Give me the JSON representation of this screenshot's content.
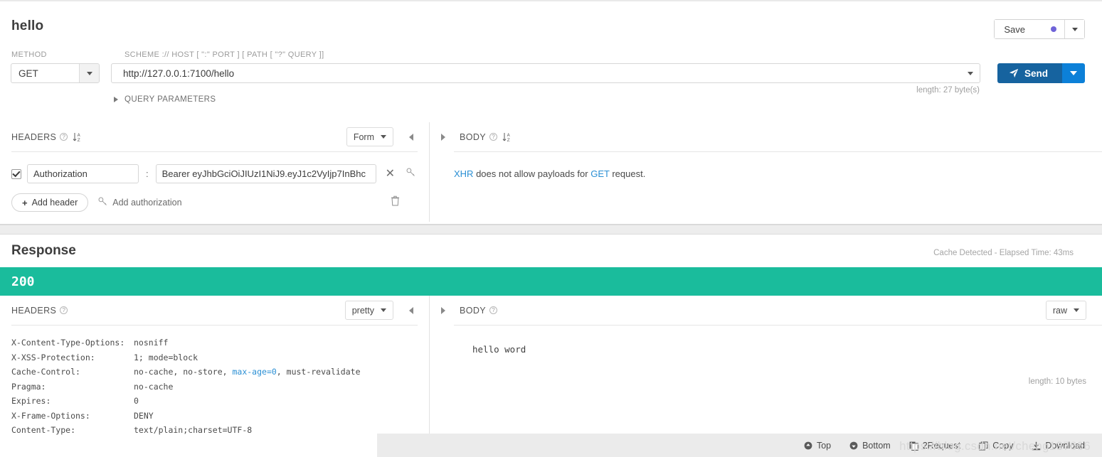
{
  "request": {
    "name": "hello",
    "save_label": "Save",
    "save_dot_color": "#6f63d8",
    "method_label": "METHOD",
    "method_value": "GET",
    "scheme_label": "SCHEME :// HOST [ \":\" PORT ] [ PATH [ \"?\" QUERY ]]",
    "url_value": "http://127.0.0.1:7100/hello",
    "url_placeholder": "http://",
    "send_label": "Send",
    "length_note": "length: 27 byte(s)",
    "query_parameters_label": "QUERY PARAMETERS",
    "headers": {
      "title": "HEADERS",
      "view_mode": "Form",
      "rows": [
        {
          "enabled": true,
          "key": "Authorization",
          "value": "Bearer eyJhbGciOiJIUzI1NiJ9.eyJ1c2VyIjp7InBhc",
          "separator": ":"
        }
      ],
      "add_header_label": "Add header",
      "add_authorization_label": "Add authorization"
    },
    "body": {
      "title": "BODY",
      "message_prefix": "XHR",
      "message_middle": " does not allow payloads for ",
      "message_method": "GET",
      "message_suffix": " request."
    }
  },
  "response": {
    "title": "Response",
    "cache_note": "Cache Detected - Elapsed Time: 43ms",
    "status_code": "200",
    "status_color": "#1abc9c",
    "headers": {
      "title": "HEADERS",
      "view_mode": "pretty",
      "rows": [
        {
          "key": "X-Content-Type-Options:",
          "value": "nosniff"
        },
        {
          "key": "X-XSS-Protection:",
          "value": "1; mode=block"
        },
        {
          "key": "Cache-Control:",
          "value": "no-cache, no-store, max-age=0, must-revalidate",
          "highlight": "max-age=0"
        },
        {
          "key": "Pragma:",
          "value": "no-cache"
        },
        {
          "key": "Expires:",
          "value": "0"
        },
        {
          "key": "X-Frame-Options:",
          "value": "DENY"
        },
        {
          "key": "Content-Type:",
          "value": "text/plain;charset=UTF-8"
        }
      ]
    },
    "body": {
      "title": "BODY",
      "view_mode": "raw",
      "content": "hello word",
      "length_note": "length: 10 bytes"
    },
    "toolbar": {
      "top": "Top",
      "bottom": "Bottom",
      "to_request": "2Request",
      "copy": "Copy",
      "download": "Download"
    }
  },
  "watermark": "https://blog.csdn.net/cheng137666"
}
